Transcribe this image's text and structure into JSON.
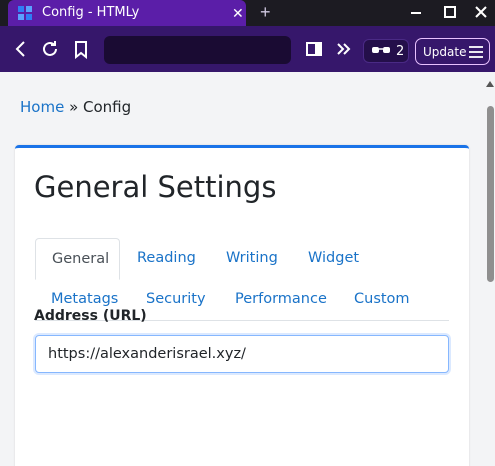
{
  "browser": {
    "tab_title": "Config - HTMLy",
    "tab_close": "✕",
    "new_tab": "+",
    "urlbar_value": "",
    "shields_count": "2",
    "update_label": "Update"
  },
  "breadcrumb": {
    "home": "Home",
    "separator": " » ",
    "current": "Config"
  },
  "card": {
    "title": "General Settings",
    "tabs": [
      {
        "label": "General",
        "active": true
      },
      {
        "label": "Reading",
        "active": false
      },
      {
        "label": "Writing",
        "active": false
      },
      {
        "label": "Widget",
        "active": false
      },
      {
        "label": "Metatags",
        "active": false
      },
      {
        "label": "Security",
        "active": false
      },
      {
        "label": "Performance",
        "active": false
      },
      {
        "label": "Custom",
        "active": false
      }
    ],
    "address_label": "Address (URL)",
    "address_value": "https://alexanderisrael.xyz/"
  },
  "colors": {
    "tab_active_bg": "#5b1ea8",
    "toolbar_bg": "#36176b",
    "link": "#1a73c8",
    "card_accent": "#1a73e8"
  }
}
